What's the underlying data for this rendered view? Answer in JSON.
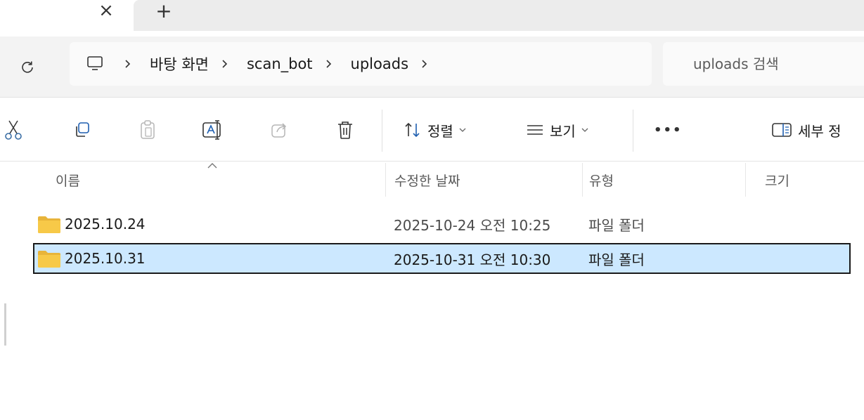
{
  "tabs": {
    "close_symbol": "×",
    "new_symbol": "+"
  },
  "nav": {
    "breadcrumb": [
      "바탕 화면",
      "scan_bot",
      "uploads"
    ],
    "search_placeholder": "uploads 검색"
  },
  "toolbar": {
    "sort_label": "정렬",
    "view_label": "보기",
    "more_label": "•••",
    "details_label": "세부 정"
  },
  "columns": {
    "name": "이름",
    "modified": "수정한 날짜",
    "type": "유형",
    "size": "크기"
  },
  "files": [
    {
      "name": "2025.10.24",
      "modified": "2025-10-24 오전 10:25",
      "type": "파일 폴더",
      "size": "",
      "selected": false
    },
    {
      "name": "2025.10.31",
      "modified": "2025-10-31 오전 10:30",
      "type": "파일 폴더",
      "size": "",
      "selected": true
    }
  ],
  "colors": {
    "accent_selected": "#cce8ff",
    "folder": "#f5c542"
  }
}
